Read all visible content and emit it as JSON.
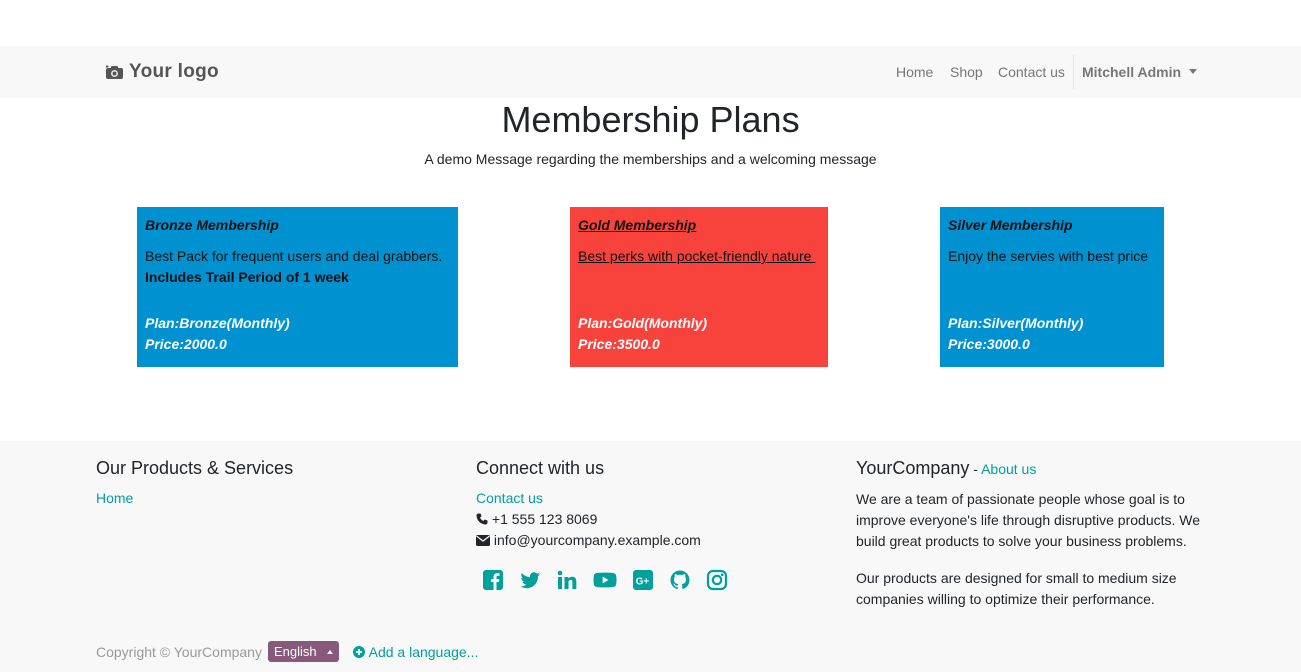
{
  "navbar": {
    "logo_text": "Your logo",
    "links": [
      "Home",
      "Shop",
      "Contact us"
    ],
    "user": "Mitchell Admin"
  },
  "hero": {
    "title": "Membership Plans",
    "subtitle": "A demo Message regarding the memberships and a welcoming message"
  },
  "cards": [
    {
      "title": "Bronze Membership",
      "description": "Best Pack for frequent users and deal grabbers.",
      "extra": "Includes Trail Period of 1 week",
      "plan": "Plan:Bronze(Monthly)",
      "price": "Price:2000.0",
      "color": "#0091d1"
    },
    {
      "title": "Gold Membership",
      "description": "Best perks with pocket-friendly nature ",
      "plan": "Plan:Gold(Monthly)",
      "price": "Price:3500.0",
      "color": "#f8433d"
    },
    {
      "title": "Silver Membership",
      "description": "Enjoy the servies with best price",
      "plan": "Plan:Silver(Monthly)",
      "price": "Price:3000.0",
      "color": "#0091d1"
    }
  ],
  "footer": {
    "col1": {
      "heading": "Our Products & Services",
      "link": "Home"
    },
    "col2": {
      "heading": "Connect with us",
      "link": "Contact us",
      "phone": "+1 555 123 8069",
      "email": "info@yourcompany.example.com",
      "social_icons": [
        "facebook-icon",
        "twitter-icon",
        "linkedin-icon",
        "youtube-icon",
        "google-plus-icon",
        "github-icon",
        "instagram-icon"
      ]
    },
    "col3": {
      "heading": "YourCompany",
      "heading_sep": " - ",
      "heading_link": "About us",
      "para1": "We are a team of passionate people whose goal is to improve everyone's life through disruptive products. We build great products to solve your business problems.",
      "para2": "Our products are designed for small to medium size companies willing to optimize their performance."
    },
    "copyright": "Copyright © YourCompany",
    "language": "English",
    "add_language": "Add a language..."
  },
  "colors": {
    "accent": "#00a09d",
    "language_button": "#875a7b",
    "navbar_bg": "#f8f8f8",
    "footer_bg": "#f8f8f8"
  }
}
